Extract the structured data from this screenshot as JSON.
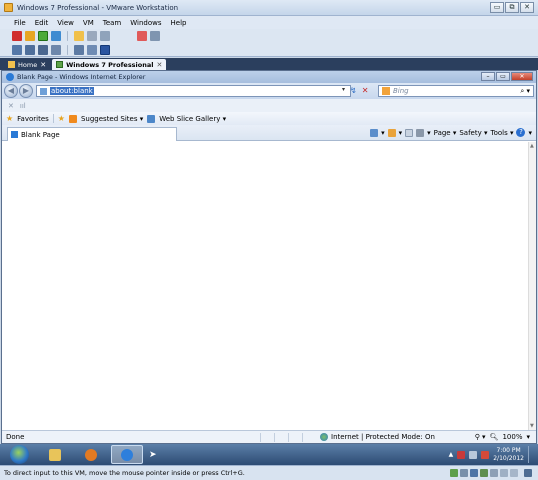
{
  "host": {
    "title": "Windows 7 Professional - VMware Workstation",
    "window_buttons": [
      "▭",
      "⧉",
      "✕"
    ],
    "menu": [
      "File",
      "Edit",
      "View",
      "VM",
      "Team",
      "Windows",
      "Help"
    ],
    "tabs": [
      {
        "label": "Home",
        "close": "✕"
      },
      {
        "label": "Windows 7 Professional",
        "close": "✕"
      }
    ],
    "status_message": "To direct input to this VM, move the mouse pointer inside or press Ctrl+G."
  },
  "ie": {
    "title": "Blank Page - Windows Internet Explorer",
    "address": "about:blank",
    "search_placeholder": "Bing",
    "favorites_label": "Favorites",
    "suggested_sites": "Suggested Sites ▾",
    "web_slice_gallery": "Web Slice Gallery ▾",
    "tab_label": "Blank Page",
    "commands": {
      "page": "Page ▾",
      "safety": "Safety ▾",
      "tools": "Tools ▾"
    },
    "status_done": "Done",
    "status_zone": "Internet | Protected Mode: On",
    "status_zoom": "100%"
  },
  "taskbar": {
    "clock_time": "7:00 PM",
    "clock_date": "2/10/2012"
  },
  "colors": {
    "host_chrome": "#dce6f2",
    "tabstrip": "#2b3f5e",
    "address_highlight": "#3a72c4",
    "taskbar": "#2d4b73"
  }
}
